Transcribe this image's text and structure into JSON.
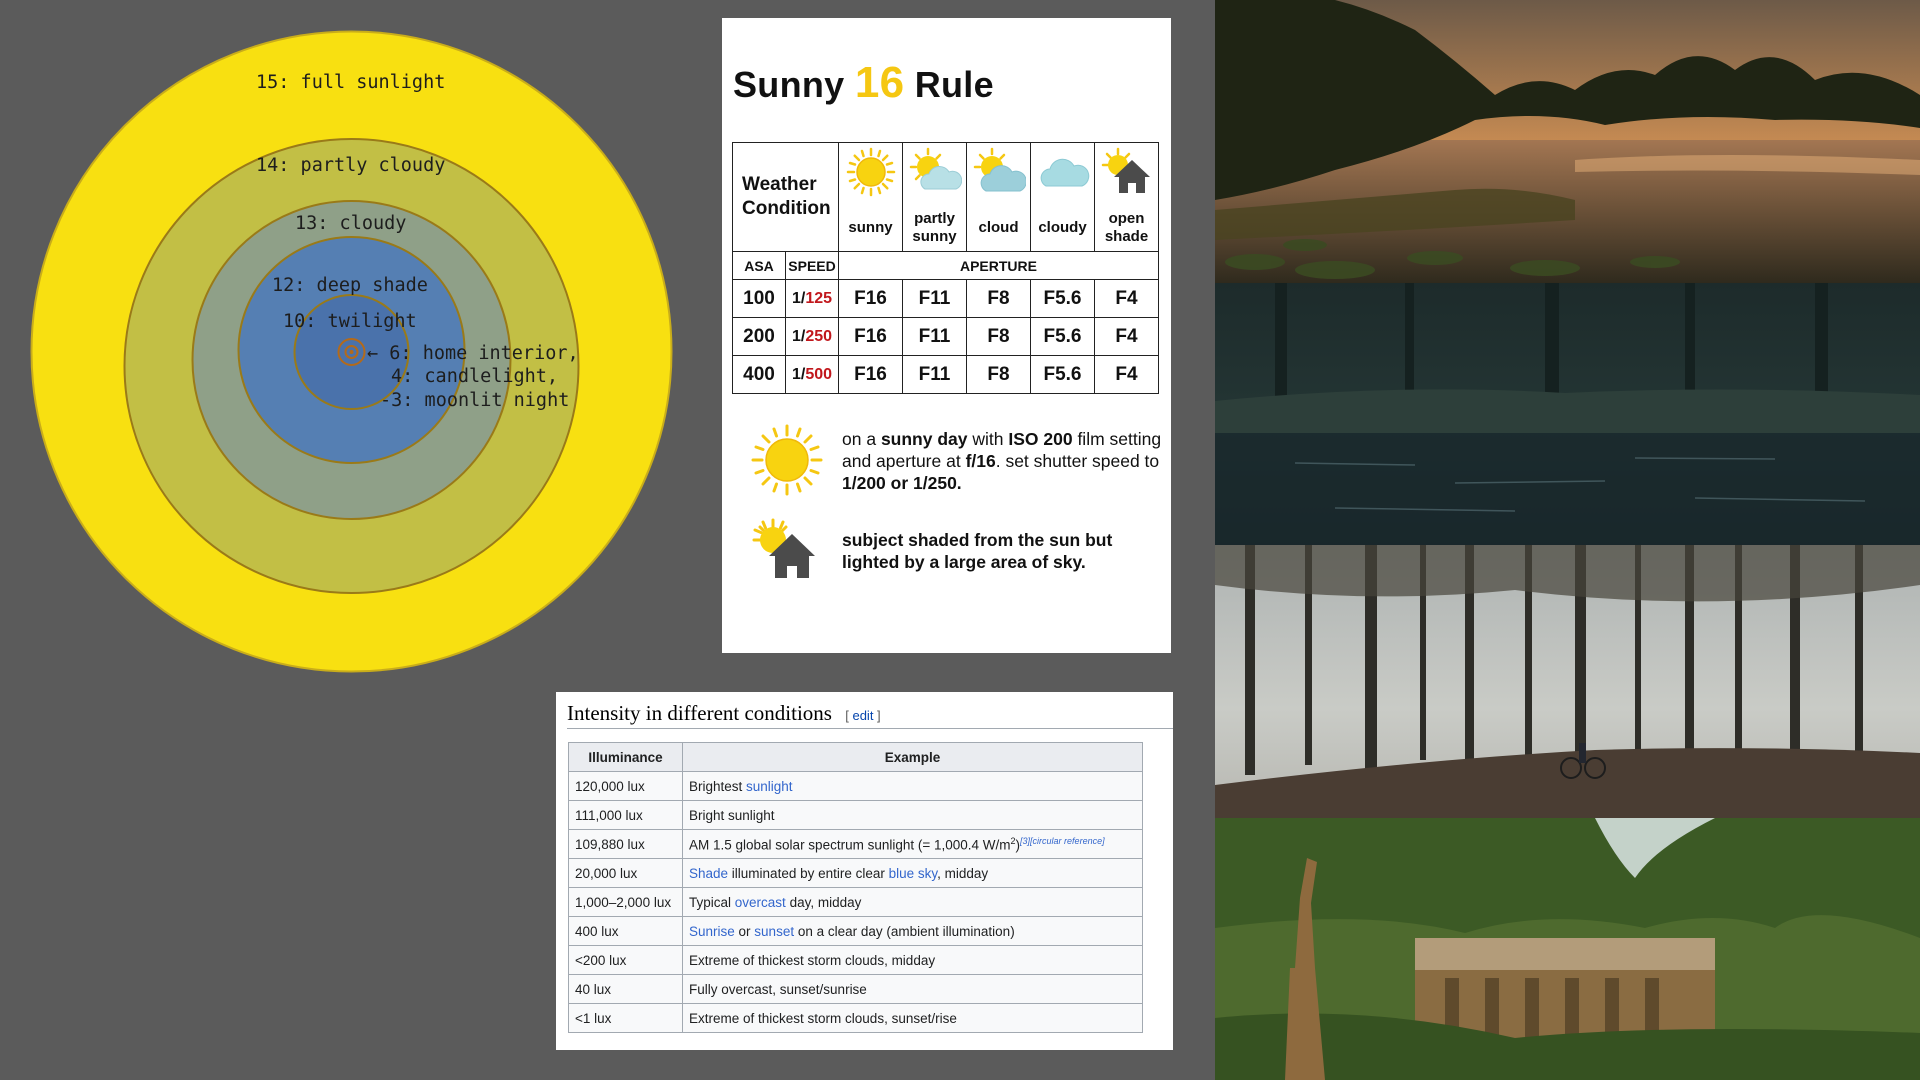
{
  "ev_diagram": {
    "labels": [
      "15: full sunlight",
      "14: partly cloudy",
      "13: cloudy",
      "12: deep shade",
      "10: twilight"
    ],
    "inner_labels": [
      "← 6: home interior,",
      "4: candlelight,",
      "-3: moonlit night"
    ],
    "colors": {
      "ring15": "#f8e011",
      "ring14": "#c2bf45",
      "ring13": "#8fa088",
      "ring12": "#557fb3",
      "ring10": "#4a72ab",
      "border": "#b38a1a"
    }
  },
  "sunny16": {
    "title_prefix": "Sunny",
    "title_number": "16",
    "title_suffix": "Rule",
    "weather_label_line1": "Weather",
    "weather_label_line2": "Condition",
    "conditions": [
      {
        "icon": "sun-icon",
        "line1": "sunny",
        "line2": ""
      },
      {
        "icon": "sun-cloud-icon",
        "line1": "partly",
        "line2": "sunny"
      },
      {
        "icon": "sun-cloud-icon",
        "line1": "cloud",
        "line2": ""
      },
      {
        "icon": "cloud-icon",
        "line1": "cloudy",
        "line2": ""
      },
      {
        "icon": "sun-house-icon",
        "line1": "open",
        "line2": "shade"
      }
    ],
    "header_asa": "ASA",
    "header_speed": "SPEED",
    "header_aperture": "APERTURE",
    "rows": [
      {
        "asa": "100",
        "speed_prefix": "1/",
        "speed_value": "125",
        "apertures": [
          "F16",
          "F11",
          "F8",
          "F5.6",
          "F4"
        ]
      },
      {
        "asa": "200",
        "speed_prefix": "1/",
        "speed_value": "250",
        "apertures": [
          "F16",
          "F11",
          "F8",
          "F5.6",
          "F4"
        ]
      },
      {
        "asa": "400",
        "speed_prefix": "1/",
        "speed_value": "500",
        "apertures": [
          "F16",
          "F11",
          "F8",
          "F5.6",
          "F4"
        ]
      }
    ],
    "note1": {
      "p1": "on a ",
      "b1": "sunny day",
      "p2": " with ",
      "b2": "ISO 200",
      "p3": " film setting and aperture at ",
      "b3": "f/16",
      "p4": ". set shutter speed to ",
      "b4": "1/200 or 1/250."
    },
    "note2": "subject shaded from the sun but lighted by a large area of sky.",
    "accent_color": "#f5c712",
    "red_color": "#c1171c"
  },
  "wiki": {
    "heading": "Intensity in different conditions",
    "edit_open": "[ ",
    "edit_label": "edit",
    "edit_close": " ]",
    "col_illuminance": "Illuminance",
    "col_example": "Example",
    "rows": [
      {
        "lux": "120,000 lux",
        "parts": [
          {
            "t": "Brightest ",
            "link": false
          },
          {
            "t": "sunlight",
            "link": true
          }
        ]
      },
      {
        "lux": "111,000 lux",
        "parts": [
          {
            "t": "Bright sunlight",
            "link": false
          }
        ]
      },
      {
        "lux": "109,880 lux",
        "parts": [
          {
            "t": "AM 1.5 global solar spectrum sunlight (= 1,000.4 W/m",
            "link": false
          }
        ],
        "sup": "2",
        "after_sup": ")",
        "cite": "[3][circular reference]"
      },
      {
        "lux": "20,000 lux",
        "parts": [
          {
            "t": "Shade",
            "link": true
          },
          {
            "t": " illuminated by entire clear ",
            "link": false
          },
          {
            "t": "blue sky",
            "link": true
          },
          {
            "t": ", midday",
            "link": false
          }
        ]
      },
      {
        "lux": "1,000–2,000 lux",
        "parts": [
          {
            "t": "Typical ",
            "link": false
          },
          {
            "t": "overcast",
            "link": true
          },
          {
            "t": " day, midday",
            "link": false
          }
        ]
      },
      {
        "lux": "400 lux",
        "parts": [
          {
            "t": "Sunrise",
            "link": true
          },
          {
            "t": " or ",
            "link": false
          },
          {
            "t": "sunset",
            "link": true
          },
          {
            "t": " on a clear day (ambient illumination)",
            "link": false
          }
        ]
      },
      {
        "lux": "<200 lux",
        "parts": [
          {
            "t": "Extreme of thickest storm clouds, midday",
            "link": false
          }
        ]
      },
      {
        "lux": "40 lux",
        "parts": [
          {
            "t": "Fully overcast, sunset/sunrise",
            "link": false
          }
        ]
      },
      {
        "lux": "<1 lux",
        "parts": [
          {
            "t": "Extreme of thickest storm clouds, sunset/rise",
            "link": false
          }
        ]
      }
    ]
  },
  "photos": [
    {
      "name": "sunset-river-photo"
    },
    {
      "name": "dark-forest-pond-photo"
    },
    {
      "name": "forest-cyclist-photo"
    },
    {
      "name": "giraffe-garden-photo"
    }
  ]
}
